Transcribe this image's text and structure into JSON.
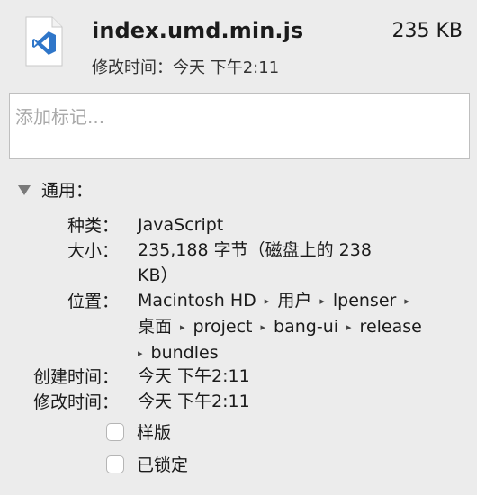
{
  "header": {
    "file_name": "index.umd.min.js",
    "file_size": "235 KB",
    "modified_label": "修改时间：",
    "modified_value": "今天 下午2:11",
    "icon": "vscode-file-icon",
    "icon_color": "#2f76c9"
  },
  "tags": {
    "placeholder": "添加标记...",
    "value": ""
  },
  "general": {
    "title": "通用：",
    "kind_label": "种类：",
    "kind_value": "JavaScript",
    "size_label": "大小：",
    "size_value_line1": "235,188 字节（磁盘上的 238",
    "size_value_line2": "KB）",
    "where_label": "位置：",
    "where_path": [
      "Macintosh HD",
      "用户",
      "lpenser",
      "桌面",
      "project",
      "bang-ui",
      "release",
      "bundles"
    ],
    "path_separator": "▸",
    "created_label": "创建时间：",
    "created_value": "今天 下午2:11",
    "modified_label": "修改时间：",
    "modified_value": "今天 下午2:11",
    "stationery_label": "样版",
    "stationery_checked": false,
    "locked_label": "已锁定",
    "locked_checked": false
  }
}
